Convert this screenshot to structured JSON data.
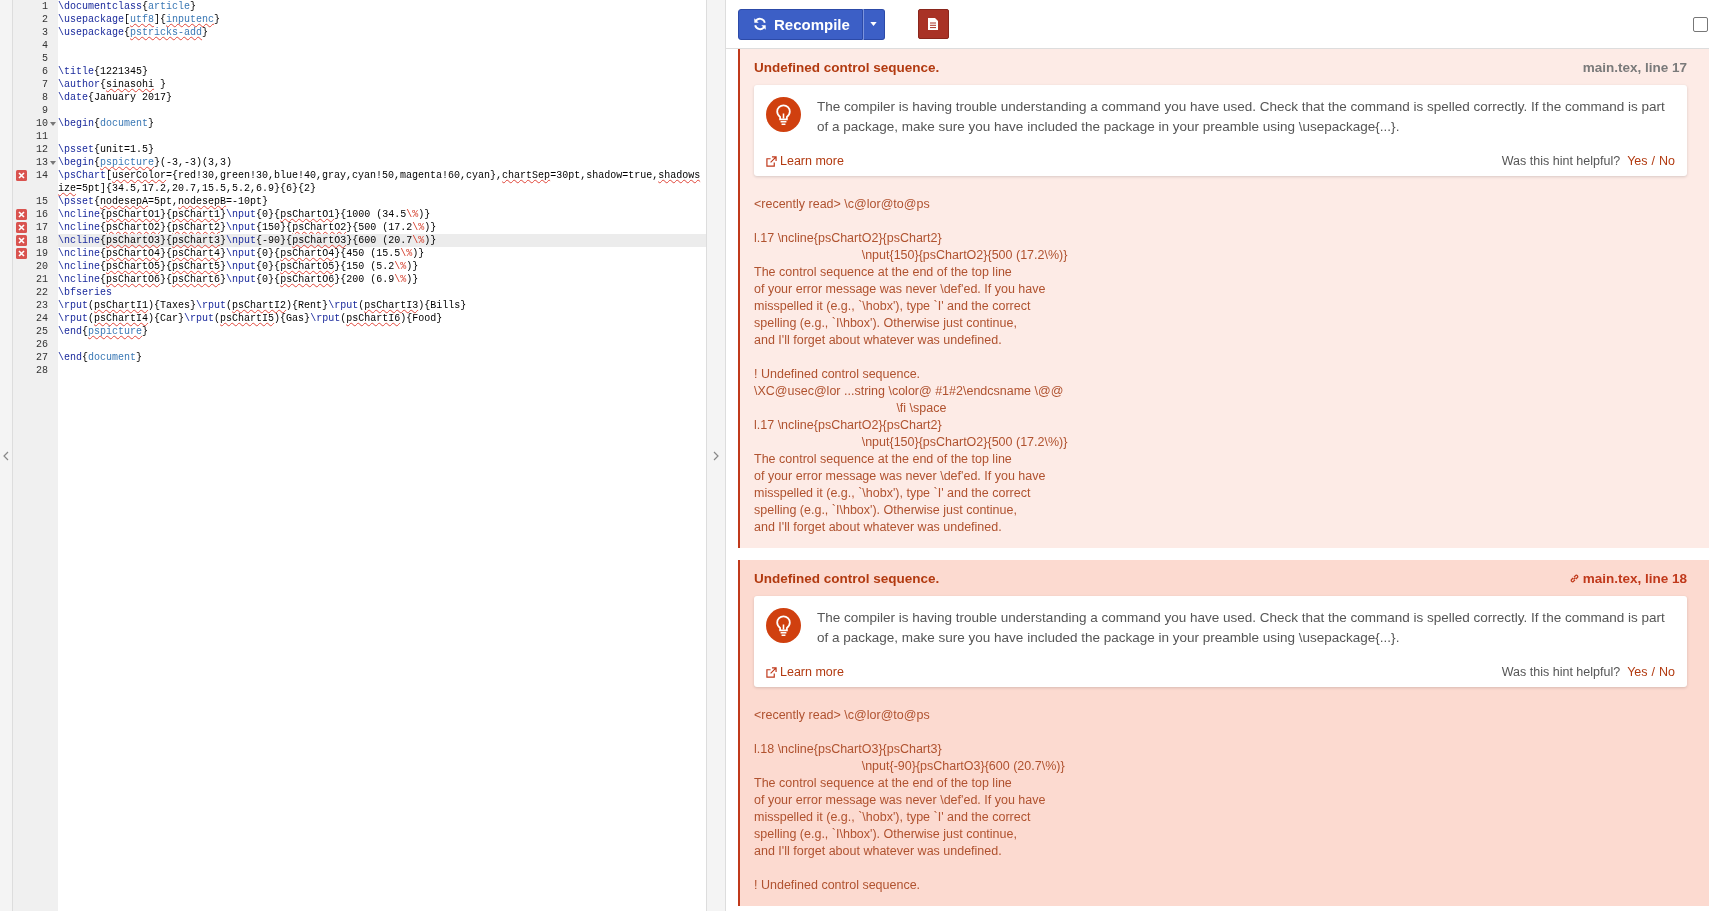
{
  "editor": {
    "lines": [
      {
        "number": "1",
        "error": false,
        "fold": false,
        "current": false,
        "tokens": [
          {
            "kind": "cmd",
            "text": "\\documentclass"
          },
          {
            "kind": "txt",
            "text": "{"
          },
          {
            "kind": "arg",
            "text": "article"
          },
          {
            "kind": "txt",
            "text": "}"
          }
        ]
      },
      {
        "number": "2",
        "error": false,
        "fold": false,
        "current": false,
        "tokens": [
          {
            "kind": "cmd",
            "text": "\\usepackage"
          },
          {
            "kind": "txt",
            "text": "["
          },
          {
            "kind": "argtypo",
            "text": "utf8"
          },
          {
            "kind": "txt",
            "text": "]{"
          },
          {
            "kind": "argtypo",
            "text": "inputenc"
          },
          {
            "kind": "txt",
            "text": "}"
          }
        ]
      },
      {
        "number": "3",
        "error": false,
        "fold": false,
        "current": false,
        "tokens": [
          {
            "kind": "cmd",
            "text": "\\usepackage"
          },
          {
            "kind": "txt",
            "text": "{"
          },
          {
            "kind": "argtypo",
            "text": "pstricks-add"
          },
          {
            "kind": "txt",
            "text": "}"
          }
        ]
      },
      {
        "number": "4",
        "error": false,
        "fold": false
      },
      {
        "number": "5",
        "error": false,
        "fold": false
      },
      {
        "number": "6",
        "error": false,
        "fold": false,
        "current": false,
        "tokens": [
          {
            "kind": "cmd",
            "text": "\\title"
          },
          {
            "kind": "txt",
            "text": "{1221345}"
          }
        ]
      },
      {
        "number": "7",
        "error": false,
        "fold": false,
        "current": false,
        "tokens": [
          {
            "kind": "cmd",
            "text": "\\author"
          },
          {
            "kind": "txt",
            "text": "{"
          },
          {
            "kind": "typo",
            "text": "sinasohi"
          },
          {
            "kind": "txt",
            "text": " }"
          }
        ]
      },
      {
        "number": "8",
        "error": false,
        "fold": false,
        "current": false,
        "tokens": [
          {
            "kind": "cmd",
            "text": "\\date"
          },
          {
            "kind": "txt",
            "text": "{January 2017}"
          }
        ]
      },
      {
        "number": "9",
        "error": false,
        "fold": false
      },
      {
        "number": "10",
        "error": false,
        "fold": true,
        "current": false,
        "tokens": [
          {
            "kind": "cmd",
            "text": "\\begin"
          },
          {
            "kind": "txt",
            "text": "{"
          },
          {
            "kind": "arg",
            "text": "document"
          },
          {
            "kind": "txt",
            "text": "}"
          }
        ]
      },
      {
        "number": "11",
        "error": false,
        "fold": false
      },
      {
        "number": "12",
        "error": false,
        "fold": false,
        "current": false,
        "tokens": [
          {
            "kind": "cmd",
            "text": "\\psset"
          },
          {
            "kind": "txt",
            "text": "{unit=1.5}"
          }
        ]
      },
      {
        "number": "13",
        "error": false,
        "fold": true,
        "current": false,
        "tokens": [
          {
            "kind": "cmd",
            "text": "\\begin"
          },
          {
            "kind": "txt",
            "text": "{"
          },
          {
            "kind": "argtypo",
            "text": "pspicture"
          },
          {
            "kind": "txt",
            "text": "}(-3,-3)(3,3)"
          }
        ]
      },
      {
        "number": "14",
        "error": true,
        "fold": false,
        "current": false,
        "tokens": [
          {
            "kind": "cmd",
            "text": "\\psChart"
          },
          {
            "kind": "txt",
            "text": "["
          },
          {
            "kind": "typo",
            "text": "userColor"
          },
          {
            "kind": "txt",
            "text": "={red!30,green!30,blue!40,gray,cyan!50,magenta!60,cyan},"
          },
          {
            "kind": "typo",
            "text": "chartSep"
          },
          {
            "kind": "txt",
            "text": "=30pt,shadow=true,"
          },
          {
            "kind": "typo",
            "text": "shadowsize"
          },
          {
            "kind": "txt",
            "text": "=5pt]{34.5,17.2,20.7,15.5,5.2,6.9}{6}{2}"
          }
        ]
      },
      {
        "number": "15",
        "error": false,
        "fold": false,
        "current": false,
        "tokens": [
          {
            "kind": "cmd",
            "text": "\\psset"
          },
          {
            "kind": "txt",
            "text": "{"
          },
          {
            "kind": "typo",
            "text": "nodesepA"
          },
          {
            "kind": "txt",
            "text": "=5pt,"
          },
          {
            "kind": "typo",
            "text": "nodesepB"
          },
          {
            "kind": "txt",
            "text": "=-10pt}"
          }
        ]
      },
      {
        "number": "16",
        "error": true,
        "fold": false,
        "current": false,
        "tokens": [
          {
            "kind": "cmd",
            "text": "\\ncline"
          },
          {
            "kind": "txt",
            "text": "{"
          },
          {
            "kind": "typo",
            "text": "psChartO1"
          },
          {
            "kind": "txt",
            "text": "}{"
          },
          {
            "kind": "typo",
            "text": "psChart1"
          },
          {
            "kind": "txt",
            "text": "}"
          },
          {
            "kind": "cmd",
            "text": "\\nput"
          },
          {
            "kind": "txt",
            "text": "{0}{"
          },
          {
            "kind": "typo",
            "text": "psChartO1"
          },
          {
            "kind": "txt",
            "text": "}{1000 (34.5"
          },
          {
            "kind": "pct",
            "text": "\\%"
          },
          {
            "kind": "txt",
            "text": ")}"
          }
        ]
      },
      {
        "number": "17",
        "error": true,
        "fold": false,
        "current": false,
        "tokens": [
          {
            "kind": "cmd",
            "text": "\\ncline"
          },
          {
            "kind": "txt",
            "text": "{"
          },
          {
            "kind": "typo",
            "text": "psChartO2"
          },
          {
            "kind": "txt",
            "text": "}{"
          },
          {
            "kind": "typo",
            "text": "psChart2"
          },
          {
            "kind": "txt",
            "text": "}"
          },
          {
            "kind": "cmd",
            "text": "\\nput"
          },
          {
            "kind": "txt",
            "text": "{150}{"
          },
          {
            "kind": "typo",
            "text": "psChartO2"
          },
          {
            "kind": "txt",
            "text": "}{500 (17.2"
          },
          {
            "kind": "pct",
            "text": "\\%"
          },
          {
            "kind": "txt",
            "text": ")}"
          }
        ]
      },
      {
        "number": "18",
        "error": true,
        "fold": false,
        "current": true,
        "tokens": [
          {
            "kind": "cmd",
            "text": "\\ncline"
          },
          {
            "kind": "txt",
            "text": "{"
          },
          {
            "kind": "typo",
            "text": "psChartO3"
          },
          {
            "kind": "txt",
            "text": "}{"
          },
          {
            "kind": "typo",
            "text": "psChart3"
          },
          {
            "kind": "txt",
            "text": "}"
          },
          {
            "kind": "cmd",
            "text": "\\nput"
          },
          {
            "kind": "txt",
            "text": "{-90}{"
          },
          {
            "kind": "typo",
            "text": "psChartO3"
          },
          {
            "kind": "txt",
            "text": "}{600 (20.7"
          },
          {
            "kind": "pct",
            "text": "\\%"
          },
          {
            "kind": "txt",
            "text": ")}"
          }
        ]
      },
      {
        "number": "19",
        "error": true,
        "fold": false,
        "current": false,
        "tokens": [
          {
            "kind": "cmd",
            "text": "\\ncline"
          },
          {
            "kind": "txt",
            "text": "{"
          },
          {
            "kind": "typo",
            "text": "psChartO4"
          },
          {
            "kind": "txt",
            "text": "}{"
          },
          {
            "kind": "typo",
            "text": "psChart4"
          },
          {
            "kind": "txt",
            "text": "}"
          },
          {
            "kind": "cmd",
            "text": "\\nput"
          },
          {
            "kind": "txt",
            "text": "{0}{"
          },
          {
            "kind": "typo",
            "text": "psChartO4"
          },
          {
            "kind": "txt",
            "text": "}{450 (15.5"
          },
          {
            "kind": "pct",
            "text": "\\%"
          },
          {
            "kind": "txt",
            "text": ")}"
          }
        ]
      },
      {
        "number": "20",
        "error": false,
        "fold": false,
        "current": false,
        "tokens": [
          {
            "kind": "cmd",
            "text": "\\ncline"
          },
          {
            "kind": "txt",
            "text": "{"
          },
          {
            "kind": "typo",
            "text": "psChartO5"
          },
          {
            "kind": "txt",
            "text": "}{"
          },
          {
            "kind": "typo",
            "text": "psChart5"
          },
          {
            "kind": "txt",
            "text": "}"
          },
          {
            "kind": "cmd",
            "text": "\\nput"
          },
          {
            "kind": "txt",
            "text": "{0}{"
          },
          {
            "kind": "typo",
            "text": "psChartO5"
          },
          {
            "kind": "txt",
            "text": "}{150 (5.2"
          },
          {
            "kind": "pct",
            "text": "\\%"
          },
          {
            "kind": "txt",
            "text": ")}"
          }
        ]
      },
      {
        "number": "21",
        "error": false,
        "fold": false,
        "current": false,
        "tokens": [
          {
            "kind": "cmd",
            "text": "\\ncline"
          },
          {
            "kind": "txt",
            "text": "{"
          },
          {
            "kind": "typo",
            "text": "psChartO6"
          },
          {
            "kind": "txt",
            "text": "}{"
          },
          {
            "kind": "typo",
            "text": "psChart6"
          },
          {
            "kind": "txt",
            "text": "}"
          },
          {
            "kind": "cmd",
            "text": "\\nput"
          },
          {
            "kind": "txt",
            "text": "{0}{"
          },
          {
            "kind": "typo",
            "text": "psChartO6"
          },
          {
            "kind": "txt",
            "text": "}{200 (6.9"
          },
          {
            "kind": "pct",
            "text": "\\%"
          },
          {
            "kind": "txt",
            "text": ")}"
          }
        ]
      },
      {
        "number": "22",
        "error": false,
        "fold": false,
        "current": false,
        "tokens": [
          {
            "kind": "cmd",
            "text": "\\bfseries"
          }
        ]
      },
      {
        "number": "23",
        "error": false,
        "fold": false,
        "current": false,
        "tokens": [
          {
            "kind": "cmd",
            "text": "\\rput"
          },
          {
            "kind": "txt",
            "text": "("
          },
          {
            "kind": "typo",
            "text": "psChartI1"
          },
          {
            "kind": "txt",
            "text": "){Taxes}"
          },
          {
            "kind": "cmd",
            "text": "\\rput"
          },
          {
            "kind": "txt",
            "text": "("
          },
          {
            "kind": "typo",
            "text": "psChartI2"
          },
          {
            "kind": "txt",
            "text": "){Rent}"
          },
          {
            "kind": "cmd",
            "text": "\\rput"
          },
          {
            "kind": "txt",
            "text": "("
          },
          {
            "kind": "typo",
            "text": "psChartI3"
          },
          {
            "kind": "txt",
            "text": "){Bills}"
          }
        ]
      },
      {
        "number": "24",
        "error": false,
        "fold": false,
        "current": false,
        "tokens": [
          {
            "kind": "cmd",
            "text": "\\rput"
          },
          {
            "kind": "txt",
            "text": "("
          },
          {
            "kind": "typo",
            "text": "psChartI4"
          },
          {
            "kind": "txt",
            "text": "){Car}"
          },
          {
            "kind": "cmd",
            "text": "\\rput"
          },
          {
            "kind": "txt",
            "text": "("
          },
          {
            "kind": "typo",
            "text": "psChartI5"
          },
          {
            "kind": "txt",
            "text": "){Gas}"
          },
          {
            "kind": "cmd",
            "text": "\\rput"
          },
          {
            "kind": "txt",
            "text": "("
          },
          {
            "kind": "typo",
            "text": "psChartI6"
          },
          {
            "kind": "txt",
            "text": "){Food}"
          }
        ]
      },
      {
        "number": "25",
        "error": false,
        "fold": false,
        "current": false,
        "tokens": [
          {
            "kind": "cmd",
            "text": "\\end"
          },
          {
            "kind": "txt",
            "text": "{"
          },
          {
            "kind": "argtypo",
            "text": "pspicture"
          },
          {
            "kind": "txt",
            "text": "}"
          }
        ]
      },
      {
        "number": "26",
        "error": false,
        "fold": false
      },
      {
        "number": "27",
        "error": false,
        "fold": false,
        "current": false,
        "tokens": [
          {
            "kind": "cmd",
            "text": "\\end"
          },
          {
            "kind": "txt",
            "text": "{"
          },
          {
            "kind": "arg",
            "text": "document"
          },
          {
            "kind": "txt",
            "text": "}"
          }
        ]
      },
      {
        "number": "28",
        "error": false,
        "fold": false
      }
    ]
  },
  "toolbar": {
    "recompile": "Recompile",
    "checked": false
  },
  "log": {
    "entries": [
      {
        "title": "Undefined control sequence.",
        "location": "main.tex, line 17",
        "selected": false,
        "hint": {
          "text": "The compiler is having trouble understanding a command you have used. Check that the command is spelled correctly. If the command is part of a package, make sure you have included the package in your preamble using \\usepackage{...}.",
          "learn_more": "Learn more",
          "prompt": "Was this hint helpful?",
          "yes": "Yes",
          "separator": "/",
          "no": "No"
        },
        "raw": "<recently read> \\c@lor@to@ps\n\nl.17 \\ncline{psChartO2}{psChart2}\n                               \\nput{150}{psChartO2}{500 (17.2\\%)}\nThe control sequence at the end of the top line\nof your error message was never \\def'ed. If you have\nmisspelled it (e.g., `\\hobx'), type `I' and the correct\nspelling (e.g., `I\\hbox'). Otherwise just continue,\nand I'll forget about whatever was undefined.\n\n! Undefined control sequence.\n\\XC@usec@lor ...string \\color@ #1#2\\endcsname \\@@\n                                         \\fi \\space\nl.17 \\ncline{psChartO2}{psChart2}\n                               \\nput{150}{psChartO2}{500 (17.2\\%)}\nThe control sequence at the end of the top line\nof your error message was never \\def'ed. If you have\nmisspelled it (e.g., `\\hobx'), type `I' and the correct\nspelling (e.g., `I\\hbox'). Otherwise just continue,\nand I'll forget about whatever was undefined."
      },
      {
        "title": "Undefined control sequence.",
        "location": "main.tex, line 18",
        "selected": true,
        "hint": {
          "text": "The compiler is having trouble understanding a command you have used. Check that the command is spelled correctly. If the command is part of a package, make sure you have included the package in your preamble using \\usepackage{...}.",
          "learn_more": "Learn more",
          "prompt": "Was this hint helpful?",
          "yes": "Yes",
          "separator": "/",
          "no": "No"
        },
        "raw": "<recently read> \\c@lor@to@ps\n\nl.18 \\ncline{psChartO3}{psChart3}\n                               \\nput{-90}{psChartO3}{600 (20.7\\%)}\nThe control sequence at the end of the top line\nof your error message was never \\def'ed. If you have\nmisspelled it (e.g., `\\hobx'), type `I' and the correct\nspelling (e.g., `I\\hbox'). Otherwise just continue,\nand I'll forget about whatever was undefined.\n\n! Undefined control sequence."
      }
    ]
  }
}
